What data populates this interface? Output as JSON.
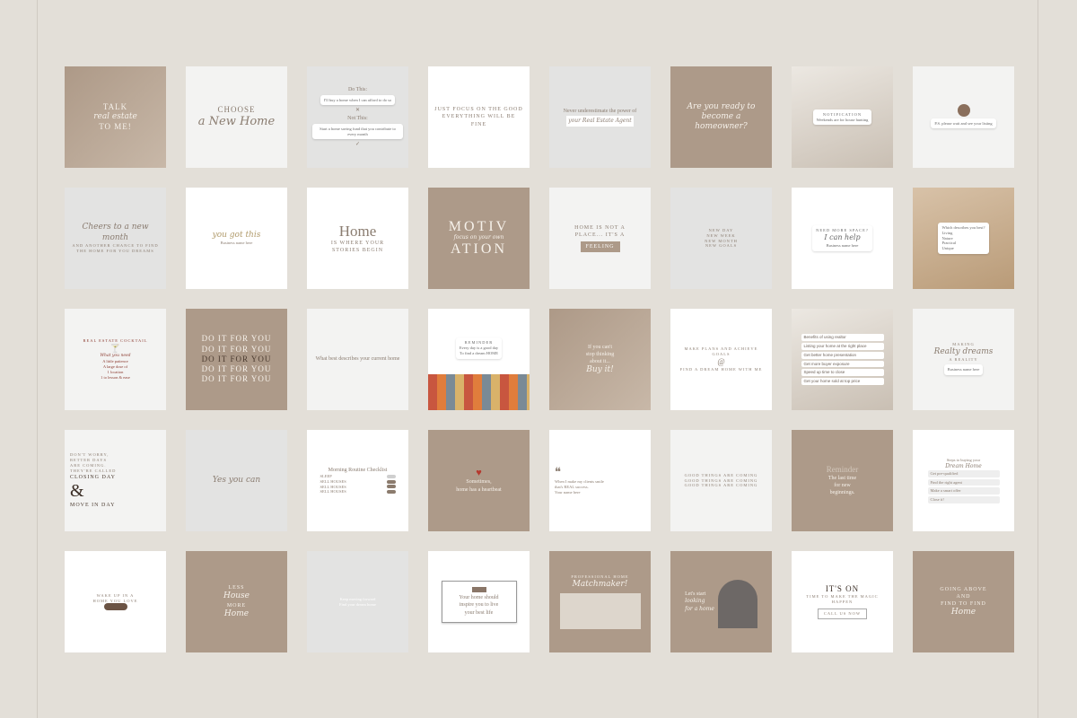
{
  "rows": [
    [
      {
        "key": "talk",
        "lines": [
          "TALK",
          "real estate",
          "TO ME!"
        ]
      },
      {
        "key": "choose",
        "lines": [
          "CHOOSE",
          "a New Home"
        ]
      },
      {
        "key": "dothis",
        "lines": [
          "Do This:",
          "I'll buy a home when I can afford to do so",
          "Not This:",
          "Start a home saving fund that you contribute to every month"
        ],
        "icons": [
          "close-icon",
          "check-icon"
        ]
      },
      {
        "key": "focus",
        "lines": [
          "JUST FOCUS ON THE GOOD",
          "EVERYTHING WILL BE FINE"
        ]
      },
      {
        "key": "never",
        "lines": [
          "Never underestimate the power of",
          "your Real Estate Agent"
        ]
      },
      {
        "key": "ready",
        "lines": [
          "Are you ready to become a homeowner?"
        ]
      },
      {
        "key": "notif",
        "lines": [
          "NOTIFICATION",
          "Weekends are for house hunting"
        ]
      },
      {
        "key": "leave",
        "lines": [
          "P.S. please wait and see your listing"
        ]
      }
    ],
    [
      {
        "key": "cheers",
        "lines": [
          "Cheers to a new month",
          "AND ANOTHER CHANCE TO FIND",
          "THE HOME FOR YOU DREAMS"
        ]
      },
      {
        "key": "yougot",
        "lines": [
          "you got this",
          "Business name here"
        ]
      },
      {
        "key": "home",
        "lines": [
          "Home",
          "IS WHERE YOUR",
          "STORIES BEGIN"
        ]
      },
      {
        "key": "motiv",
        "lines": [
          "MOTIV",
          "ATION",
          "focus on your own"
        ]
      },
      {
        "key": "notplace",
        "lines": [
          "HOME IS NOT A",
          "PLACE... IT'S A",
          "FEELING"
        ]
      },
      {
        "key": "newday",
        "lines": [
          "NEW DAY",
          "NEW WEEK",
          "NEW MONTH",
          "NEW GOALS"
        ]
      },
      {
        "key": "space",
        "lines": [
          "NEED MORE SPACE?",
          "I can help",
          "Business name here"
        ]
      },
      {
        "key": "describe",
        "lines": [
          "Which describes you best?",
          "Living",
          "Nature",
          "Practical",
          "Unique"
        ]
      }
    ],
    [
      {
        "key": "cocktail",
        "lines": [
          "REAL ESTATE COCKTAIL",
          "What you need",
          "A little patience",
          "A large dose of",
          "1 location",
          "1 to lesson & ease"
        ]
      },
      {
        "key": "doit",
        "lines": [
          "DO IT FOR YOU",
          "DO IT FOR YOU",
          "DO IT FOR YOU",
          "DO IT FOR YOU",
          "DO IT FOR YOU"
        ]
      },
      {
        "key": "whatbest",
        "lines": [
          "What best describes your current home"
        ]
      },
      {
        "key": "reminder",
        "lines": [
          "REMINDER",
          "Every day is a good day",
          "To find a dream HOME"
        ]
      },
      {
        "key": "cant",
        "lines": [
          "If you can't",
          "stop thinking",
          "about it...",
          "Buy it!"
        ]
      },
      {
        "key": "plans",
        "lines": [
          "MAKE PLANS AND ACHIEVE GOALS",
          "FIND A DREAM HOME WITH ME"
        ]
      },
      {
        "key": "search",
        "lines": [
          "Benefits of using realtor",
          "Listing your home at the right place",
          "Get better home presentation",
          "Get more buyer exposure",
          "Speed up time to close",
          "Get your home sold at top price"
        ]
      },
      {
        "key": "making",
        "lines": [
          "MAKING",
          "Realty dreams",
          "A REALITY",
          "Business name here"
        ]
      }
    ],
    [
      {
        "key": "dontworry",
        "lines": [
          "DON'T WORRY,",
          "BETTER DAYS",
          "ARE COMING.",
          "THEY'RE CALLED",
          "CLOSING DAY",
          "&",
          "MOVE IN DAY"
        ]
      },
      {
        "key": "yesyou",
        "lines": [
          "Yes you can"
        ]
      },
      {
        "key": "morning",
        "lines": [
          "Morning Routine Checklist",
          "SLEEP",
          "SELL HOUSES",
          "SELL HOUSES",
          "SELL HOUSES"
        ]
      },
      {
        "key": "heartbeat",
        "lines": [
          "Sometimes,",
          "home has a heartbeat"
        ]
      },
      {
        "key": "quote",
        "lines": [
          "When I make my clients smile that's REAL success.",
          "Your name here"
        ]
      },
      {
        "key": "goodthings",
        "lines": [
          "GOOD THINGS ARE COMING",
          "GOOD THINGS ARE COMING",
          "GOOD THINGS ARE COMING"
        ]
      },
      {
        "key": "lasttime",
        "lines": [
          "Reminder",
          "The last time",
          "for new",
          "beginnings."
        ]
      },
      {
        "key": "steps",
        "lines": [
          "Steps to buying your",
          "Dream Home",
          "Get pre-qualified",
          "Find the right agent",
          "Make a smart offer",
          "Close it!"
        ]
      }
    ],
    [
      {
        "key": "wakeup",
        "lines": [
          "WAKE UP IN A",
          "HOME YOU LOVE"
        ]
      },
      {
        "key": "less",
        "lines": [
          "LESS",
          "House",
          "MORE",
          "Home"
        ]
      },
      {
        "key": "circle",
        "lines": [
          "Keep moving forward",
          "Find your dream home"
        ]
      },
      {
        "key": "inspire",
        "lines": [
          "Your home should",
          "inspire you to live",
          "your best life"
        ]
      },
      {
        "key": "matchmaker",
        "lines": [
          "PROFESSIONAL HOME",
          "Matchmaker!"
        ]
      },
      {
        "key": "letsstart",
        "lines": [
          "Let's start",
          "looking",
          "for a home"
        ]
      },
      {
        "key": "itson",
        "lines": [
          "IT'S ON",
          "TIME TO MAKE THE MAGIC HAPPEN",
          "CALL US NOW"
        ]
      },
      {
        "key": "goingabove",
        "lines": [
          "GOING ABOVE",
          "AND",
          "FIND TO FIND",
          "Home"
        ]
      }
    ]
  ]
}
